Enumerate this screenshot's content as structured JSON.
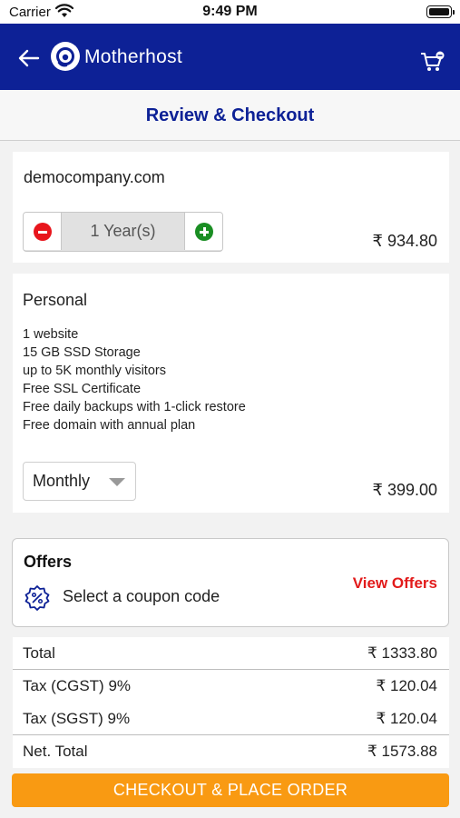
{
  "status_bar": {
    "carrier": "Carrier",
    "time": "9:49 PM"
  },
  "app_bar": {
    "brand": "Motherhost",
    "brand_color": "#0d2196"
  },
  "page": {
    "title": "Review & Checkout"
  },
  "domain_item": {
    "name": "democompany.com",
    "duration_value": "1 Year(s)",
    "price": "₹ 934.80"
  },
  "plan_item": {
    "name": "Personal",
    "features": [
      "1 website",
      "15 GB SSD Storage",
      "up to 5K monthly visitors",
      "Free SSL Certificate",
      "Free daily backups with 1-click restore",
      "Free domain with annual plan"
    ],
    "billing_cycle": "Monthly",
    "price": "₹ 399.00"
  },
  "offers": {
    "title": "Offers",
    "coupon_label": "Select a coupon code",
    "view_offers_label": "View Offers",
    "accent_color": "#e21b1b"
  },
  "summary": {
    "total_label": "Total",
    "total_value": "₹ 1333.80",
    "cgst_label": "Tax (CGST) 9%",
    "cgst_value": "₹ 120.04",
    "sgst_label": "Tax (SGST) 9%",
    "sgst_value": "₹ 120.04",
    "net_label": "Net. Total",
    "net_value": "₹ 1573.88"
  },
  "checkout": {
    "label": "CHECKOUT & PLACE ORDER",
    "color": "#f99a12"
  },
  "icons": [
    "wifi-icon",
    "battery-icon",
    "back-arrow-icon",
    "logo-icon",
    "cart-icon",
    "minus-icon",
    "plus-icon",
    "chevron-down-icon",
    "coupon-icon"
  ]
}
